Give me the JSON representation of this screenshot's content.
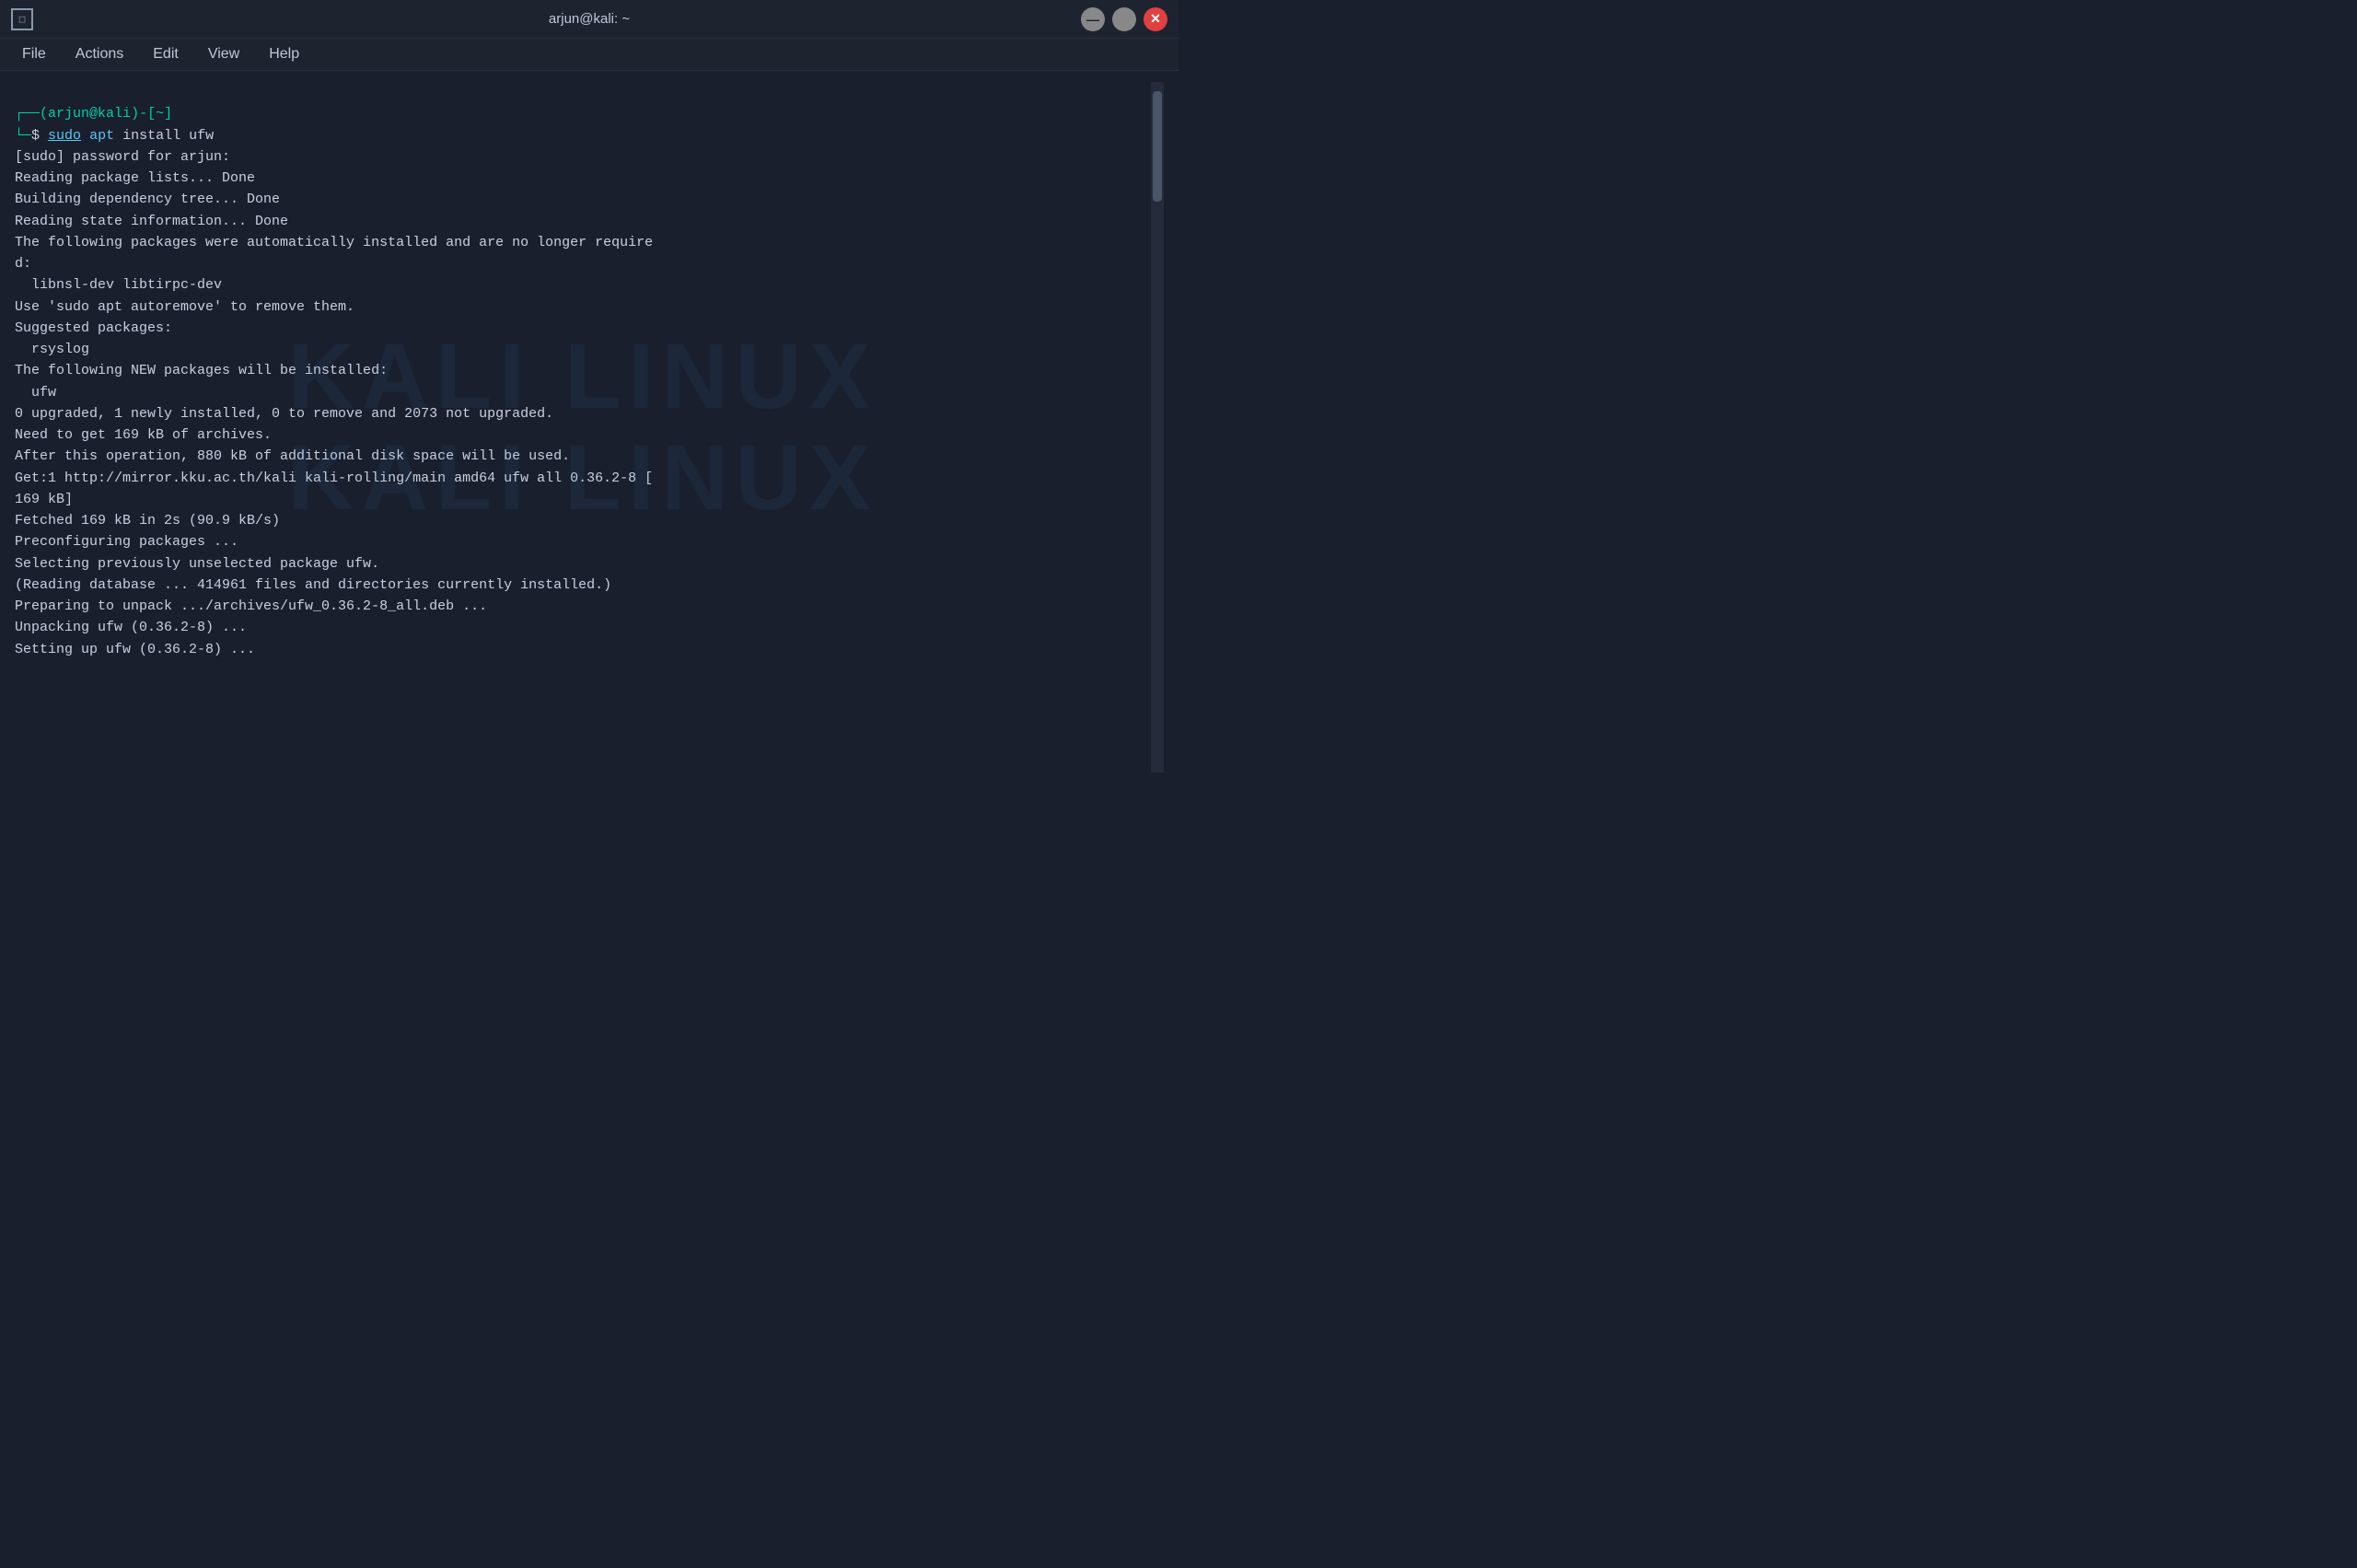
{
  "titleBar": {
    "title": "arjun@kali: ~",
    "windowIcon": "□"
  },
  "menuBar": {
    "items": [
      "File",
      "Actions",
      "Edit",
      "View",
      "Help"
    ]
  },
  "terminal": {
    "lines": [
      {
        "type": "prompt",
        "text": "(arjun@kali)-[~]"
      },
      {
        "type": "command",
        "sudo": "sudo",
        "apt": "apt",
        "rest": " install ufw"
      },
      {
        "type": "normal",
        "text": "[sudo] password for arjun:"
      },
      {
        "type": "normal",
        "text": "Reading package lists... Done"
      },
      {
        "type": "normal",
        "text": "Building dependency tree... Done"
      },
      {
        "type": "normal",
        "text": "Reading state information... Done"
      },
      {
        "type": "normal",
        "text": "The following packages were automatically installed and are no longer require\nd:"
      },
      {
        "type": "normal",
        "text": "  libnsl-dev libtirpc-dev"
      },
      {
        "type": "normal",
        "text": "Use 'sudo apt autoremove' to remove them."
      },
      {
        "type": "normal",
        "text": "Suggested packages:"
      },
      {
        "type": "normal",
        "text": "  rsyslog"
      },
      {
        "type": "normal",
        "text": "The following NEW packages will be installed:"
      },
      {
        "type": "normal",
        "text": "  ufw"
      },
      {
        "type": "normal",
        "text": "0 upgraded, 1 newly installed, 0 to remove and 2073 not upgraded."
      },
      {
        "type": "normal",
        "text": "Need to get 169 kB of archives."
      },
      {
        "type": "normal",
        "text": "After this operation, 880 kB of additional disk space will be used."
      },
      {
        "type": "normal",
        "text": "Get:1 http://mirror.kku.ac.th/kali kali-rolling/main amd64 ufw all 0.36.2-8 [\n169 kB]"
      },
      {
        "type": "normal",
        "text": "Fetched 169 kB in 2s (90.9 kB/s)"
      },
      {
        "type": "normal",
        "text": "Preconfiguring packages ..."
      },
      {
        "type": "normal",
        "text": "Selecting previously unselected package ufw."
      },
      {
        "type": "normal",
        "text": "(Reading database ... 414961 files and directories currently installed.)"
      },
      {
        "type": "normal",
        "text": "Preparing to unpack .../archives/ufw_0.36.2-8_all.deb ..."
      },
      {
        "type": "normal",
        "text": "Unpacking ufw (0.36.2-8) ..."
      },
      {
        "type": "normal",
        "text": "Setting up ufw (0.36.2-8) ..."
      }
    ]
  },
  "watermark": {
    "line1": "KALI LINUX",
    "line2": "KALI LINUX"
  }
}
